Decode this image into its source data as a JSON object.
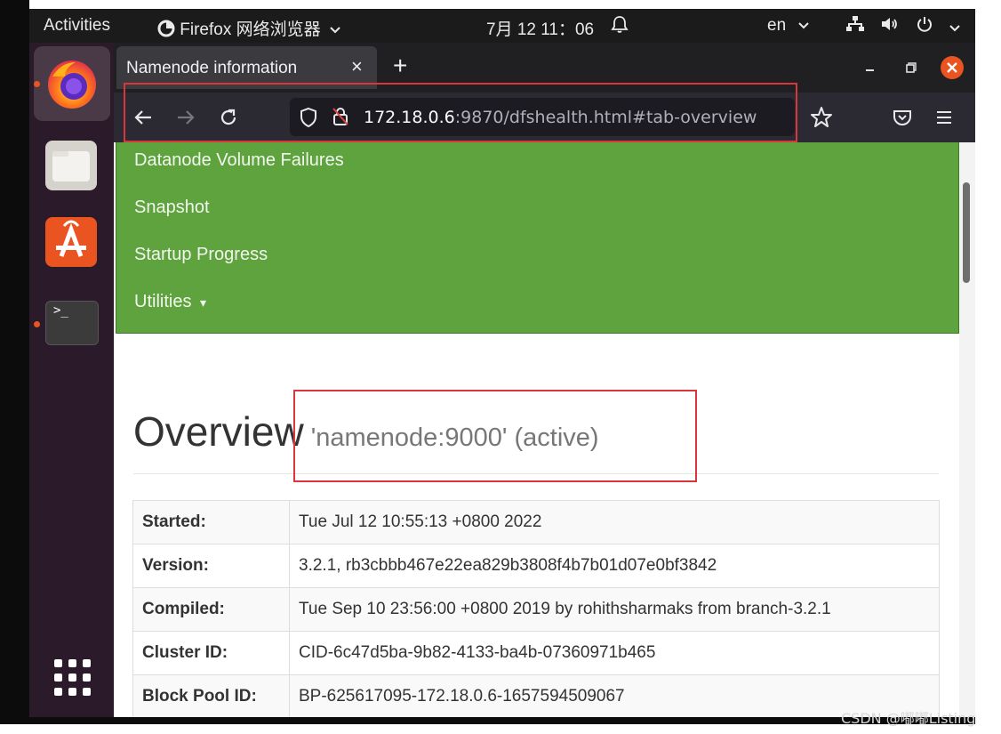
{
  "topbar": {
    "activities": "Activities",
    "app_name": "Firefox 网络浏览器",
    "app_menu_arrow": "chevron-down",
    "clock": "7月 12  11：06",
    "alarm_icon": "alarm-icon",
    "lang": "en",
    "colors": {
      "bg": "#1b1b1b",
      "text": "#eaeaea"
    }
  },
  "dock": {
    "apps": [
      {
        "name": "firefox",
        "running": true
      },
      {
        "name": "files",
        "running": false
      },
      {
        "name": "software-center",
        "running": false
      },
      {
        "name": "terminal",
        "running": true
      }
    ],
    "terminal_prompt": ">_",
    "accent": "#e95420"
  },
  "browser": {
    "tab_title": "Namenode information",
    "tab_close": "×",
    "new_tab": "+",
    "url_host": "172.18.0.6",
    "url_rest": ":9870/dfshealth.html#tab-overview"
  },
  "menu": {
    "items": [
      "Datanode Volume Failures",
      "Snapshot",
      "Startup Progress",
      "Utilities"
    ],
    "caret": "▾",
    "color": "#5fa33f"
  },
  "overview": {
    "title": "Overview",
    "subtitle": "'namenode:9000' (active)"
  },
  "info_table": [
    {
      "label": "Started:",
      "value": "Tue Jul 12 10:55:13 +0800 2022"
    },
    {
      "label": "Version:",
      "value": "3.2.1, rb3cbbb467e22ea829b3808f4b7b01d07e0bf3842"
    },
    {
      "label": "Compiled:",
      "value": "Tue Sep 10 23:56:00 +0800 2019 by rohithsharmaks from branch-3.2.1"
    },
    {
      "label": "Cluster ID:",
      "value": "CID-6c47d5ba-9b82-4133-ba4b-07360971b465"
    },
    {
      "label": "Block Pool ID:",
      "value": "BP-625617095-172.18.0.6-1657594509067"
    }
  ],
  "watermark": "CSDN @嘟嘟Listing",
  "highlight_color": "#d9363e"
}
